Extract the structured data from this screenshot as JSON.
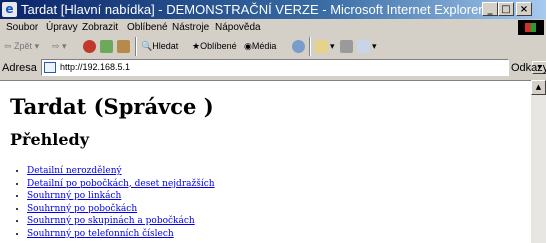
{
  "window": {
    "title": "Tardat [Hlavní nabídka] - DEMONSTRAČNÍ VERZE - Microsoft Internet Explorer",
    "minimize": "_",
    "maximize": "□",
    "close": "×"
  },
  "menu": [
    "Soubor",
    "Úpravy",
    "Zobrazit",
    "Oblíbené",
    "Nástroje",
    "Nápověda"
  ],
  "toolbar": {
    "back": "Zpět",
    "search": "Hledat",
    "favorites": "Oblíbené",
    "media": "Média"
  },
  "address": {
    "label": "Adresa",
    "url": "http://192.168.5.1",
    "go_label": "Odkazy"
  },
  "page": {
    "title": "Tardat (Správce )",
    "section": "Přehledy",
    "links": [
      "Detailní nerozdělený",
      "Detailní po pobočkách, deset nejdražších",
      "Souhrnný po linkách",
      "Souhrnný po pobočkách",
      "Souhrnný po skupinách a pobočkách",
      "Souhrnný po telefonních číslech"
    ]
  }
}
